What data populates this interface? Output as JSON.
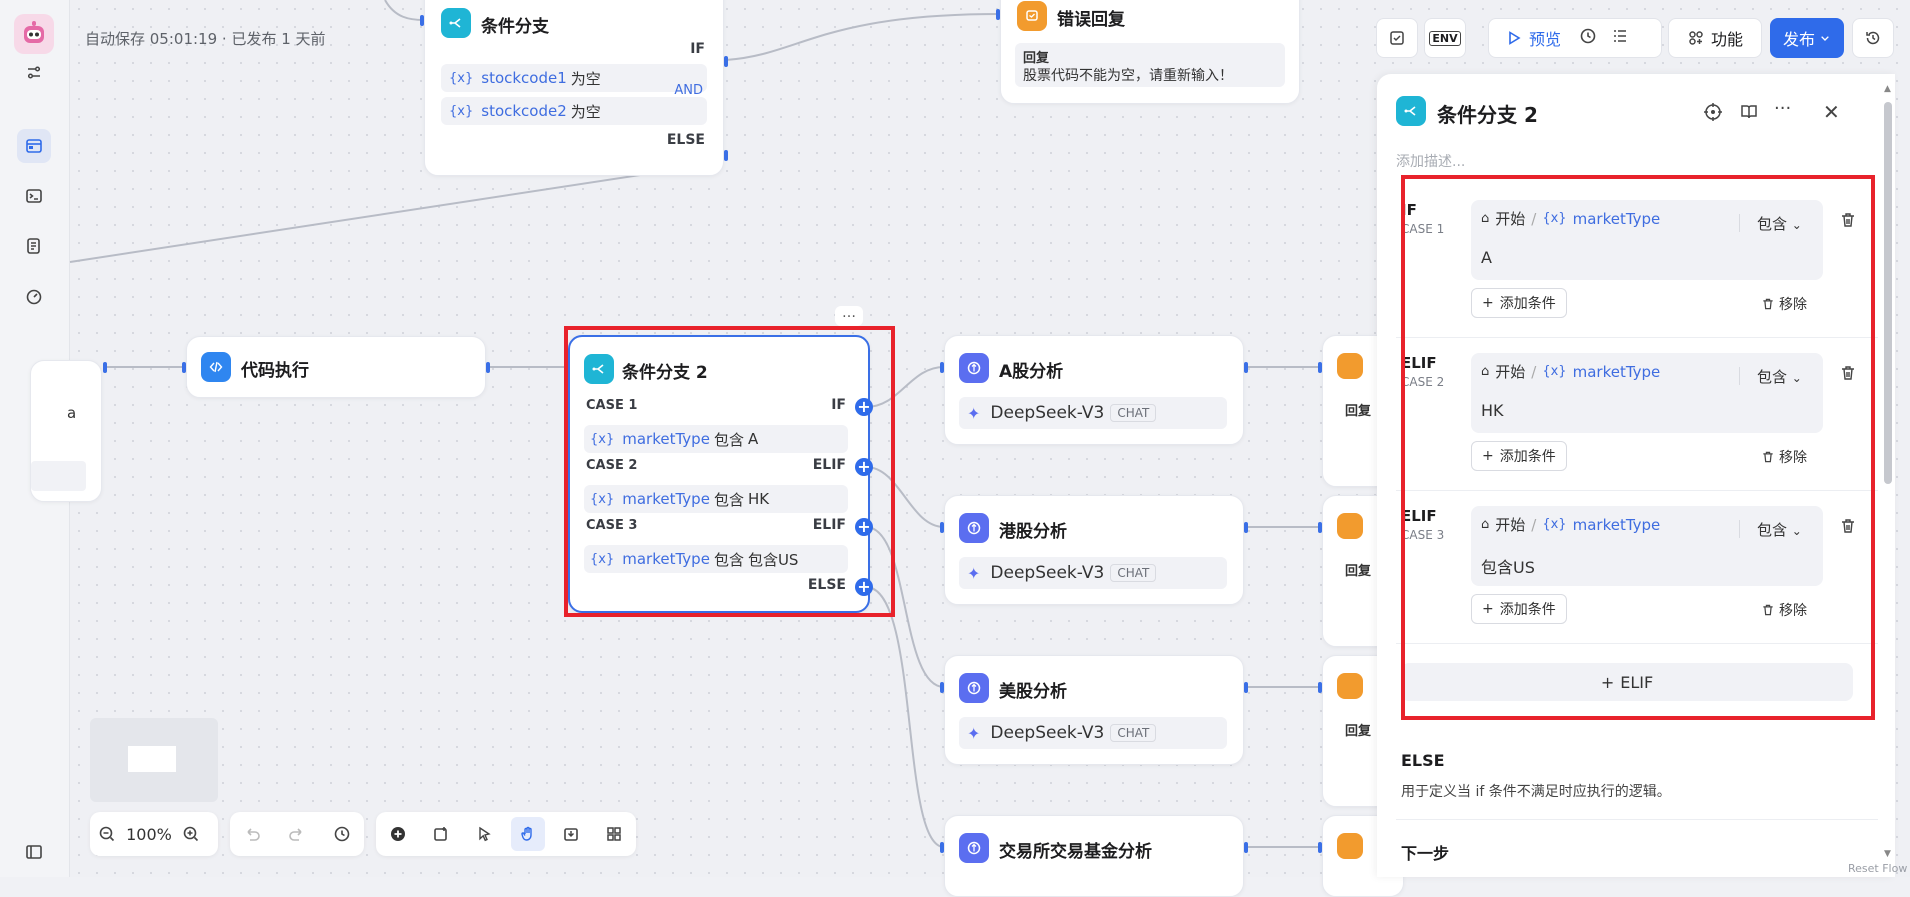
{
  "sidebar": {
    "items": [
      "avatar",
      "settings-sliders",
      "workflow",
      "terminal",
      "notes",
      "dashboard",
      "panel-toggle"
    ]
  },
  "canvas": {
    "autosave": "自动保存 05:01:19 · 已发布 1 天前",
    "top_branch": {
      "title": "条件分支",
      "if_label": "IF",
      "cond1_var": "stockcode1",
      "cond1_op": "为空",
      "cond2_var": "stockcode2",
      "cond2_op": "为空",
      "and_label": "AND",
      "else_label": "ELSE"
    },
    "error_reply": {
      "title": "错误回复",
      "reply_label": "回复",
      "reply_text": "股票代码不能为空，请重新输入！"
    },
    "code_exec": {
      "title": "代码执行"
    },
    "left_partial": {
      "text": "a"
    },
    "branch2": {
      "title": "条件分支 2",
      "more": "…",
      "cases": [
        {
          "case": "CASE 1",
          "kind": "IF",
          "var": "marketType",
          "op": "包含",
          "val": "A"
        },
        {
          "case": "CASE 2",
          "kind": "ELIF",
          "var": "marketType",
          "op": "包含",
          "val": "HK"
        },
        {
          "case": "CASE 3",
          "kind": "ELIF",
          "var": "marketType",
          "op": "包含",
          "val": "包含US"
        }
      ],
      "else_label": "ELSE"
    },
    "analysis": [
      {
        "title": "A股分析",
        "model": "DeepSeek-V3",
        "tag": "CHAT"
      },
      {
        "title": "港股分析",
        "model": "DeepSeek-V3",
        "tag": "CHAT"
      },
      {
        "title": "美股分析",
        "model": "DeepSeek-V3",
        "tag": "CHAT"
      },
      {
        "title": "交易所交易基金分析"
      }
    ],
    "reply_partial": {
      "label": "回复"
    },
    "reset_flow": "Reset Flow"
  },
  "toolbar": {
    "preview": "预览",
    "features": "功能",
    "publish": "发布",
    "env": "ENV"
  },
  "panel": {
    "title": "条件分支 2",
    "desc_placeholder": "添加描述...",
    "conditions": [
      {
        "kind": "IF",
        "case": "CASE 1",
        "start": "开始",
        "var": "marketType",
        "op": "包含",
        "value": "A",
        "add": "添加条件",
        "remove": "移除"
      },
      {
        "kind": "ELIF",
        "case": "CASE 2",
        "start": "开始",
        "var": "marketType",
        "op": "包含",
        "value": "HK",
        "add": "添加条件",
        "remove": "移除"
      },
      {
        "kind": "ELIF",
        "case": "CASE 3",
        "start": "开始",
        "var": "marketType",
        "op": "包含",
        "value": "包含US",
        "add": "添加条件",
        "remove": "移除"
      }
    ],
    "add_elif": "ELIF",
    "else_title": "ELSE",
    "else_desc": "用于定义当 if 条件不满足时应执行的逻辑。",
    "next_step": "下一步"
  },
  "bottom": {
    "zoom": "100%"
  },
  "colors": {
    "accent": "#2f6bea",
    "publish": "#2f6bea",
    "highlight": "#e8222b",
    "branch_icon": "#1fb5d5",
    "llm_icon": "#5b6ef0",
    "reply_icon": "#f29b2e"
  }
}
